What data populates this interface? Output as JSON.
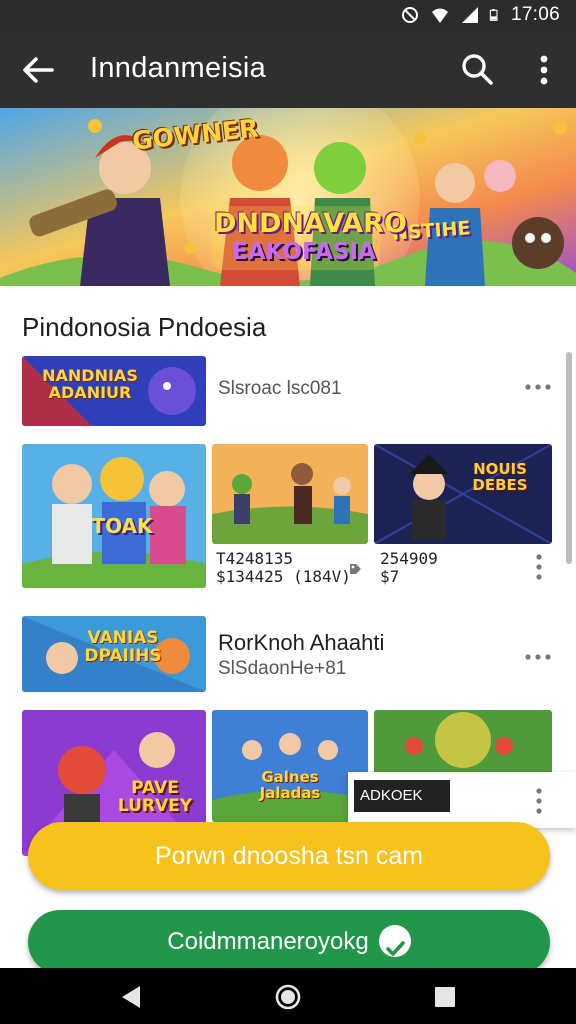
{
  "status_bar": {
    "time": "17:06",
    "icons": [
      "no-disturb-icon",
      "wifi-icon",
      "signal-icon",
      "battery-icon"
    ]
  },
  "app_bar": {
    "title": "Inndanmeisia",
    "icons": [
      "back-arrow-icon",
      "search-icon",
      "more-vert-icon"
    ]
  },
  "banner": {
    "text_left": "GOWNER",
    "text_right": "NSTIHE",
    "title_line1": "DNDNAVARO",
    "title_line2": "EAKOFASIA"
  },
  "section": {
    "title": "Pindonosia Pndoesia"
  },
  "row1": {
    "thumb_text": "NANDNIAS ADANIUR",
    "label": "Slsroac lsc081"
  },
  "grid1": {
    "thumbs": [
      {
        "text": "TOAK"
      },
      {
        "text": ""
      },
      {
        "text": "NOUIS DEBES"
      }
    ],
    "items": [
      {
        "price_line1": "T4248135",
        "price_line2": "$134425 (184V)"
      },
      {
        "price_line1": "254909",
        "price_line2": "$7"
      }
    ]
  },
  "row2": {
    "thumb_text": "VANIAS DPAIIHS",
    "title": "RorKnoh Ahaahti",
    "label": "SlSdaonHe+81"
  },
  "grid2": {
    "thumbs": [
      {
        "text": "PAVE LURVEY"
      },
      {
        "text": "Galnes Jaladas"
      },
      {
        "text": ""
      }
    ],
    "popup_label": "ADKOEK"
  },
  "buttons": {
    "primary": "Porwn dnoosha tsn cam",
    "secondary": "Coidmmaneroyokg"
  },
  "colors": {
    "app_bar": "#2f2f2f",
    "status_bar": "#2b2b2b",
    "primary_button": "#f7c21b",
    "secondary_button": "#22964a",
    "nav_bar": "#000000"
  }
}
